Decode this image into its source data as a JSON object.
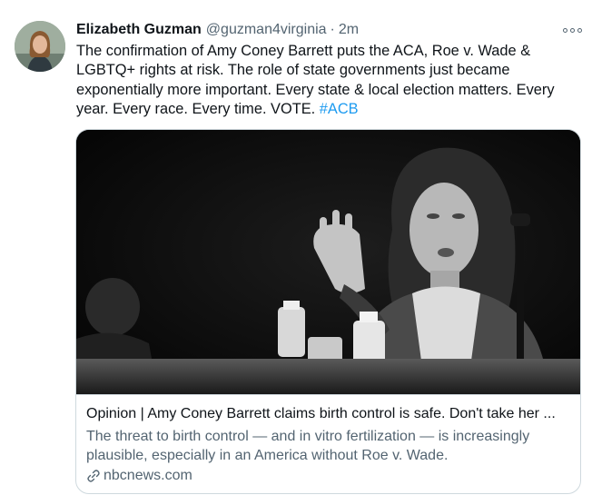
{
  "tweet": {
    "author_name": "Elizabeth Guzman",
    "handle": "@guzman4virginia",
    "separator": "·",
    "time": "2m",
    "text_main": "The confirmation of Amy Coney Barrett puts the ACA, Roe v. Wade & LGBTQ+ rights at risk. The role of state governments just became exponentially more important. Every state & local election matters. Every year. Every race. Every time. VOTE. ",
    "hashtag": "#ACB"
  },
  "card": {
    "title": "Opinion | Amy Coney Barrett claims birth control is safe. Don't take her ...",
    "description": "The threat to birth control — and in vitro fertilization — is increasingly plausible, especially in an America without Roe v. Wade.",
    "domain": "nbcnews.com",
    "image_alt": "Black and white photo of Amy Coney Barrett speaking at a hearing microphone"
  },
  "icons": {
    "more": "more-icon",
    "link": "link-icon"
  },
  "colors": {
    "accent": "#1d9bf0",
    "secondary_text": "#536471",
    "border": "#cfd9de"
  }
}
